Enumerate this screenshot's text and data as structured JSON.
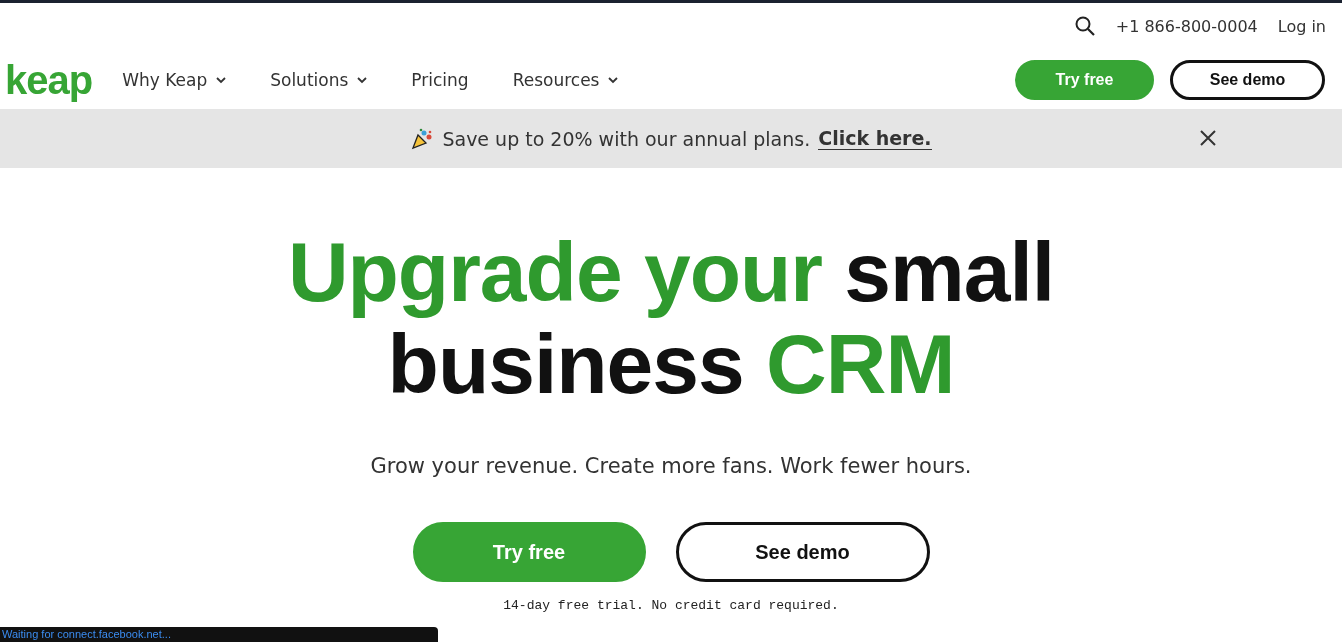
{
  "utility": {
    "phone": "+1 866-800-0004",
    "login": "Log in"
  },
  "nav": {
    "logo": "keap",
    "items": [
      {
        "label": "Why Keap",
        "dropdown": true
      },
      {
        "label": "Solutions",
        "dropdown": true
      },
      {
        "label": "Pricing",
        "dropdown": false
      },
      {
        "label": "Resources",
        "dropdown": true
      }
    ],
    "buttons": [
      {
        "label": "Try free",
        "kind": "primary"
      },
      {
        "label": "See demo",
        "kind": "outline"
      }
    ]
  },
  "banner": {
    "text": "Save up to 20% with our annual plans.",
    "link": "Click here."
  },
  "hero": {
    "lines": [
      [
        {
          "text": "Upgrade your",
          "accent": true
        },
        {
          "text": "small",
          "accent": false
        }
      ],
      [
        {
          "text": "business",
          "accent": false
        },
        {
          "text": "CRM",
          "accent": true
        }
      ]
    ],
    "subtitle": "Grow your revenue. Create more fans. Work fewer hours.",
    "buttons": [
      {
        "label": "Try free",
        "kind": "primary"
      },
      {
        "label": "See demo",
        "kind": "outline"
      }
    ],
    "note": "14-day free trial. No credit card required."
  },
  "status_bar": "Waiting for connect.facebook.net..."
}
